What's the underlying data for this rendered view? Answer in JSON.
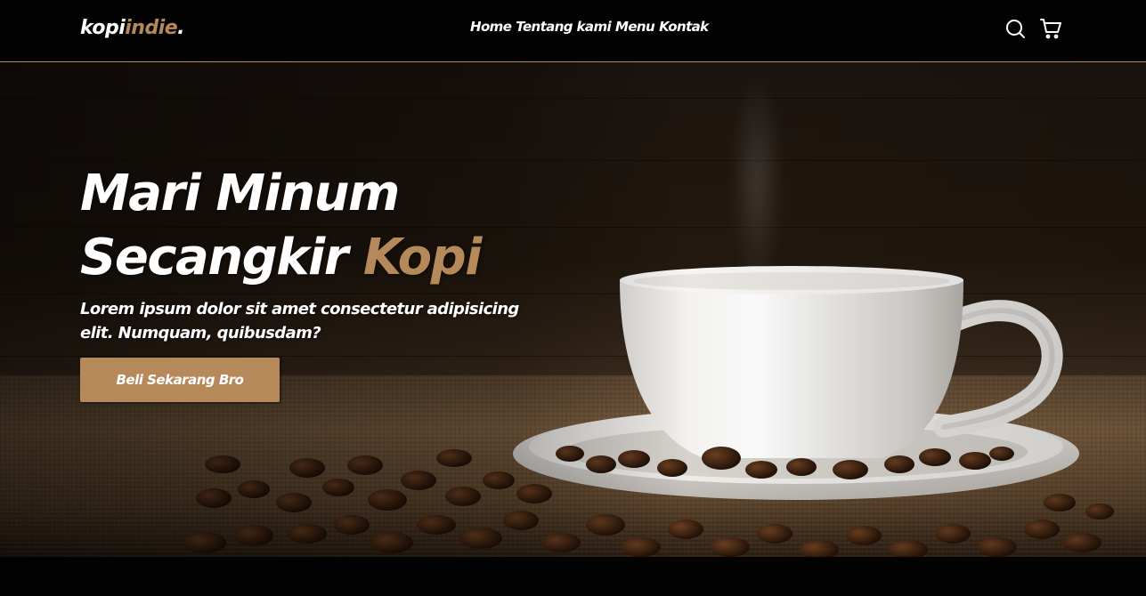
{
  "navbar": {
    "logo": {
      "primary": "kopi",
      "accent": "indie",
      "suffix": "."
    },
    "links": [
      "Home",
      "Tentang kami",
      "Menu",
      "Kontak"
    ],
    "icons": [
      "search-icon",
      "shopping-cart-icon"
    ]
  },
  "hero": {
    "title_line1": "Mari Minum",
    "title_line2_prefix": "Secangkir ",
    "title_line2_accent": "Kopi",
    "text": "Lorem ipsum dolor sit amet consectetur adipisicing elit. Numquam, quibusdam?",
    "cta_label": "Beli Sekarang Bro"
  },
  "colors": {
    "accent": "#b6895b",
    "background": "#010101",
    "text": "#ffffff"
  }
}
